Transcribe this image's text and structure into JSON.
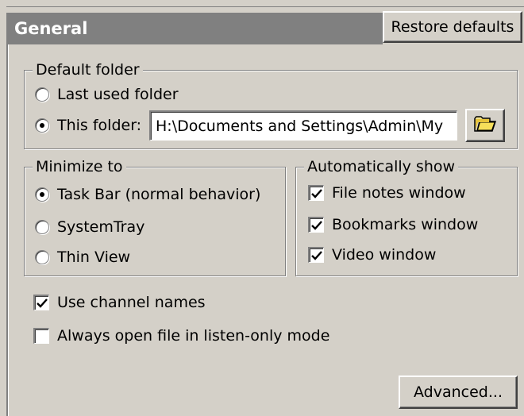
{
  "header": {
    "title": "General",
    "restore_label": "Restore defaults"
  },
  "default_folder": {
    "legend": "Default folder",
    "last_used_label": "Last used folder",
    "this_folder_label": "This folder:",
    "path_value": "H:\\Documents and Settings\\Admin\\My",
    "selected": "this_folder",
    "browse_icon": "folder-icon"
  },
  "minimize_to": {
    "legend": "Minimize to",
    "options": [
      {
        "label": "Task Bar (normal behavior)",
        "checked": true
      },
      {
        "label": "SystemTray",
        "checked": false
      },
      {
        "label": "Thin View",
        "checked": false
      }
    ]
  },
  "auto_show": {
    "legend": "Automatically show",
    "items": [
      {
        "label": "File notes window",
        "checked": true
      },
      {
        "label": "Bookmarks window",
        "checked": true
      },
      {
        "label": "Video window",
        "checked": true
      }
    ]
  },
  "options": [
    {
      "label": "Use channel names",
      "checked": true
    },
    {
      "label": "Always open file in listen-only mode",
      "checked": false
    }
  ],
  "advanced_label": "Advanced...",
  "colors": {
    "face": "#d4d0c8",
    "header": "#808080",
    "header_text": "#ffffff"
  }
}
